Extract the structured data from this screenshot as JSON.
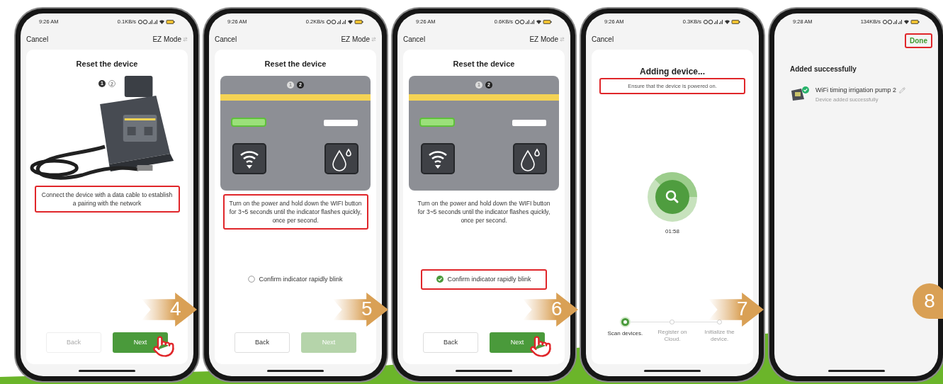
{
  "phones": [
    {
      "kind": "connect",
      "status": {
        "time": "9:26 AM",
        "speed": "0.1KB/s"
      },
      "header": {
        "cancel": "Cancel",
        "mode": "EZ Mode"
      },
      "title": "Reset the device",
      "pages": [
        {
          "label": "1",
          "selected": true
        },
        {
          "label": "2",
          "selected": false
        }
      ],
      "instruction": {
        "text": "Connect the device with a data cable to establish a pairing with the network",
        "highlighted": true
      },
      "back": {
        "label": "Back",
        "disabled": true
      },
      "next": {
        "label": "Next",
        "disabled": false
      },
      "tap": true
    },
    {
      "kind": "reset",
      "status": {
        "time": "9:26 AM",
        "speed": "0.2KB/s"
      },
      "header": {
        "cancel": "Cancel",
        "mode": "EZ Mode"
      },
      "title": "Reset the device",
      "pages": [
        {
          "label": "1",
          "selected": false
        },
        {
          "label": "2",
          "selected": true
        }
      ],
      "instruction": {
        "text": "Turn on the power and hold down the WIFI button for 3~5 seconds until the indicator flashes quickly, once per second.",
        "highlighted": true
      },
      "confirm": {
        "label": "Confirm indicator rapidly blink",
        "checked": false,
        "highlighted": false
      },
      "back": {
        "label": "Back",
        "disabled": false
      },
      "next": {
        "label": "Next",
        "disabled": true
      },
      "tap": false
    },
    {
      "kind": "reset",
      "status": {
        "time": "9:26 AM",
        "speed": "0.6KB/s"
      },
      "header": {
        "cancel": "Cancel",
        "mode": "EZ Mode"
      },
      "title": "Reset the device",
      "pages": [
        {
          "label": "1",
          "selected": false
        },
        {
          "label": "2",
          "selected": true
        }
      ],
      "instruction": {
        "text": "Turn on the power and hold down the WIFI button for 3~5 seconds until the indicator flashes quickly, once per second.",
        "highlighted": false
      },
      "confirm": {
        "label": "Confirm indicator rapidly blink",
        "checked": true,
        "highlighted": true
      },
      "back": {
        "label": "Back",
        "disabled": false
      },
      "next": {
        "label": "Next",
        "disabled": false
      },
      "tap": true
    },
    {
      "kind": "adding",
      "status": {
        "time": "9:26 AM",
        "speed": "0.3KB/s"
      },
      "header": {
        "cancel": "Cancel"
      },
      "title": "Adding device...",
      "subtitle": {
        "text": "Ensure that the device is powered on.",
        "highlighted": true
      },
      "timer": "01:58",
      "steps": [
        {
          "label": "Scan devices.",
          "done": true
        },
        {
          "label": "Register on Cloud.",
          "done": false
        },
        {
          "label": "Initialize the device.",
          "done": false
        }
      ]
    },
    {
      "kind": "done",
      "status": {
        "time": "9:28 AM",
        "speed": "134KB/s"
      },
      "header": {
        "done": "Done",
        "highlighted": true
      },
      "title": "Added successfully",
      "device": {
        "name": "WiFi timing irrigation pump 2",
        "status": "Device added successfully"
      }
    }
  ],
  "step_markers": [
    {
      "label": "4",
      "kind": "arrow"
    },
    {
      "label": "5",
      "kind": "arrow"
    },
    {
      "label": "6",
      "kind": "arrow"
    },
    {
      "label": "7",
      "kind": "arrow"
    },
    {
      "label": "8",
      "kind": "pin"
    }
  ]
}
